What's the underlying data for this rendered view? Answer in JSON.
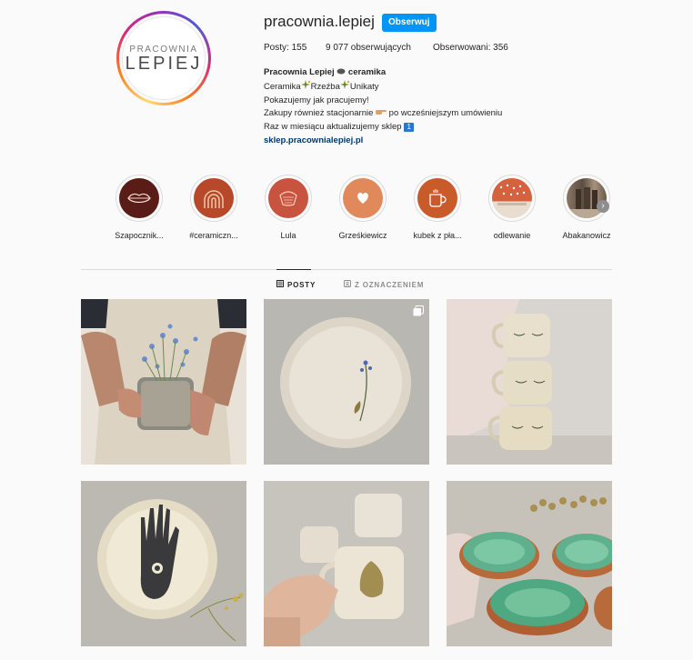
{
  "profile": {
    "username": "pracownia.lepiej",
    "follow_label": "Obserwuj",
    "logo_top": "PRACOWNIA",
    "logo_bottom": "LEPIEJ",
    "stats": {
      "posts": "Posty: 155",
      "followers": "9 077 obserwujących",
      "following": "Obserwowani: 356"
    },
    "bio": {
      "name": "Pracownia Lepiej",
      "name_suffix": " ceramika",
      "line1": "Ceramika",
      "line1_b": "Rzeźba",
      "line1_c": "Unikaty",
      "line2": "Pokazujemy jak pracujemy!",
      "line3a": "Zakupy również stacjonarnie ",
      "line3b": " po wcześniejszym umówieniu",
      "line4": "Raz w miesiącu aktualizujemy sklep ",
      "line4_badge": "1",
      "link": "sklep.pracownialepiej.pl"
    }
  },
  "highlights": [
    {
      "label": "Szapocznik...",
      "color": "#5a1c17",
      "icon": "lips-icon"
    },
    {
      "label": "#ceramiczn...",
      "color": "#b8482a",
      "icon": "rainbow-icon"
    },
    {
      "label": "Lula",
      "color": "#c8533e",
      "icon": "basket-icon"
    },
    {
      "label": "Grześkiewicz",
      "color": "#e2895b",
      "icon": "heart-icon"
    },
    {
      "label": "kubek z pła...",
      "color": "#c95a2a",
      "icon": "mug-icon"
    },
    {
      "label": "odlewanie",
      "color": "#d96a48",
      "icon": "photo-icon"
    },
    {
      "label": "Abakanowicz",
      "color": "#7a6a5a",
      "icon": "photo-icon"
    }
  ],
  "tabs": {
    "posts": "POSTY",
    "tagged": "Z OZNACZENIEM"
  },
  "colors": {
    "accent": "#0095f6",
    "link": "#00376b"
  }
}
